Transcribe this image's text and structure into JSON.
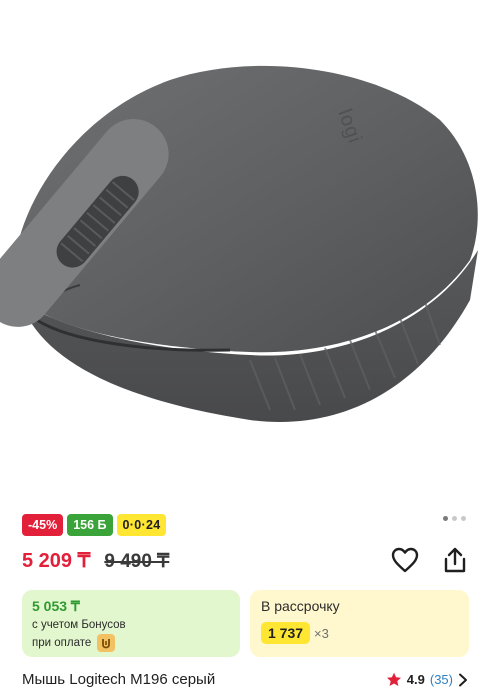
{
  "image": {
    "alt": "Мышь Logitech M196 серый"
  },
  "badges": {
    "discount": "-45%",
    "bonus": "156 Б",
    "installment": "0·0·24"
  },
  "gallery": {
    "dots": 3,
    "active_index": 0
  },
  "price": {
    "current": "5 209 ₸",
    "old": "9 490 ₸"
  },
  "actions": {
    "favorite_icon": "heart-icon",
    "share_icon": "share-icon"
  },
  "bonus_card": {
    "price": "5 053 ₸",
    "line1": "с учетом Бонусов",
    "line2": "при оплате"
  },
  "installment_card": {
    "label": "В рассрочку",
    "amount": "1 737",
    "times": "×3"
  },
  "product": {
    "title": "Мышь Logitech M196 серый",
    "rating": "4.9",
    "reviews": "(35)"
  },
  "colors": {
    "accent_red": "#e3203a",
    "bonus_green": "#3aa33a",
    "installment_yellow": "#ffe632",
    "link_blue": "#2f7fc1"
  }
}
